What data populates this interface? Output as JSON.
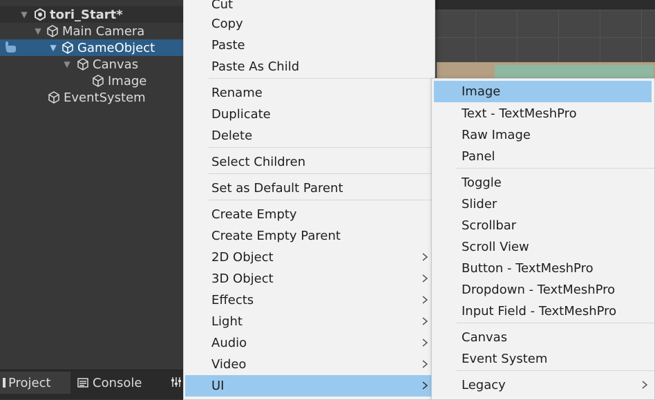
{
  "hierarchy": {
    "scene_name": "tori_Start*",
    "items": [
      {
        "label": "Main Camera"
      },
      {
        "label": "GameObject"
      },
      {
        "label": "Canvas"
      },
      {
        "label": "Image"
      },
      {
        "label": "EventSystem"
      }
    ]
  },
  "tabs": {
    "project": "Project",
    "console": "Console"
  },
  "context_menu": {
    "items": [
      {
        "label": "Cut"
      },
      {
        "label": "Copy"
      },
      {
        "label": "Paste"
      },
      {
        "label": "Paste As Child"
      },
      {
        "label": "Rename"
      },
      {
        "label": "Duplicate"
      },
      {
        "label": "Delete"
      },
      {
        "label": "Select Children"
      },
      {
        "label": "Set as Default Parent"
      },
      {
        "label": "Create Empty"
      },
      {
        "label": "Create Empty Parent"
      },
      {
        "label": "2D Object"
      },
      {
        "label": "3D Object"
      },
      {
        "label": "Effects"
      },
      {
        "label": "Light"
      },
      {
        "label": "Audio"
      },
      {
        "label": "Video"
      },
      {
        "label": "UI"
      }
    ]
  },
  "ui_submenu": {
    "items": [
      {
        "label": "Image"
      },
      {
        "label": "Text - TextMeshPro"
      },
      {
        "label": "Raw Image"
      },
      {
        "label": "Panel"
      },
      {
        "label": "Toggle"
      },
      {
        "label": "Slider"
      },
      {
        "label": "Scrollbar"
      },
      {
        "label": "Scroll View"
      },
      {
        "label": "Button - TextMeshPro"
      },
      {
        "label": "Dropdown - TextMeshPro"
      },
      {
        "label": "Input Field - TextMeshPro"
      },
      {
        "label": "Canvas"
      },
      {
        "label": "Event System"
      },
      {
        "label": "Legacy"
      }
    ]
  },
  "colors": {
    "selection": "#2c5d87",
    "menu_highlight": "#99c9ef",
    "menu_bg": "#f2f2f2"
  }
}
